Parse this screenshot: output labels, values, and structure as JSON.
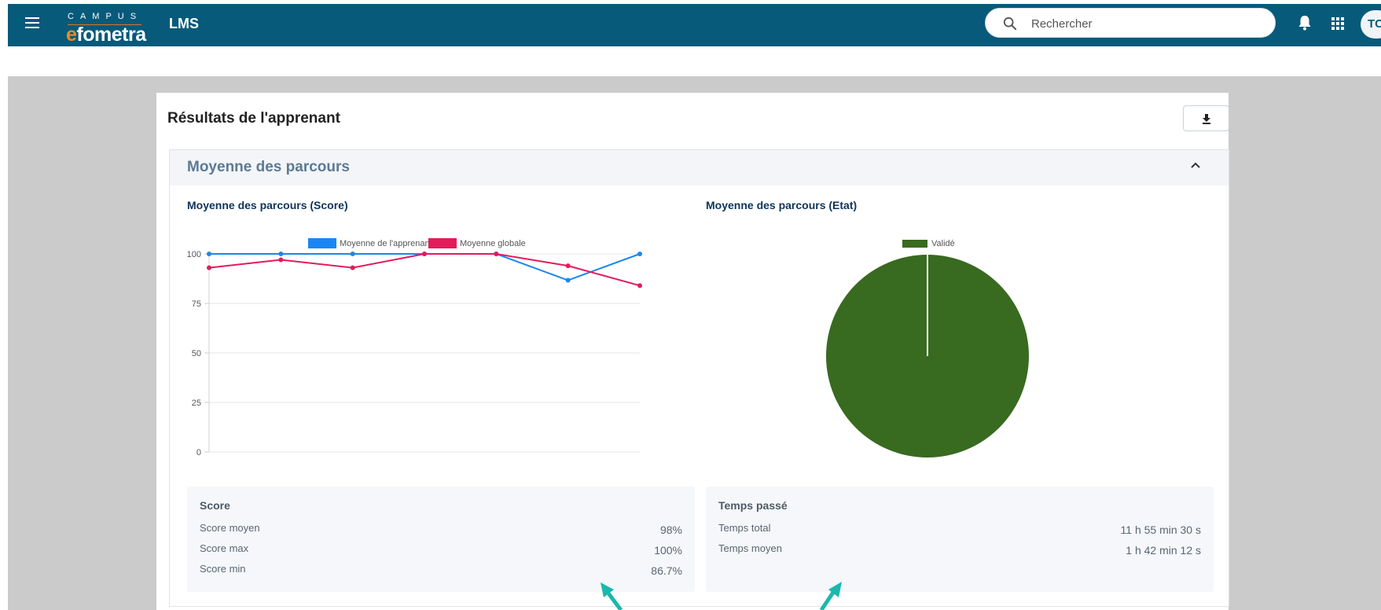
{
  "topbar": {
    "logo_top": "CAMPUS",
    "logo_e": "e",
    "logo_rest": "fometra",
    "app_title": "LMS",
    "search_placeholder": "Rechercher",
    "avatar_initials": "TC"
  },
  "card": {
    "title": "Résultats de l'apprenant",
    "section_title": "Moyenne des parcours"
  },
  "score_chart": {
    "title": "Moyenne des parcours (Score)"
  },
  "state_chart": {
    "title": "Moyenne des parcours (Etat)"
  },
  "chart_data": [
    {
      "type": "line",
      "title": "Moyenne des parcours (Score)",
      "x": [
        1,
        2,
        3,
        4,
        5,
        6,
        7
      ],
      "series": [
        {
          "name": "Moyenne de l'apprenant",
          "color": "#1a86f3",
          "values": [
            100,
            100,
            100,
            100,
            100,
            86.7,
            100
          ]
        },
        {
          "name": "Moyenne globale",
          "color": "#e31b5b",
          "values": [
            93,
            97,
            93,
            100,
            100,
            94,
            84
          ]
        }
      ],
      "yticks": [
        "100",
        "75",
        "50",
        "25",
        "0"
      ],
      "ylim": [
        0,
        100
      ],
      "grid": true,
      "legend": "top"
    },
    {
      "type": "pie",
      "title": "Moyenne des parcours (Etat)",
      "labels": [
        "Validé"
      ],
      "values": [
        100
      ],
      "colors": [
        "#386a1f"
      ],
      "legend": "top"
    }
  ],
  "score_stats": {
    "heading": "Score",
    "rows": [
      {
        "label": "Score moyen",
        "value": "98%"
      },
      {
        "label": "Score max",
        "value": "100%"
      },
      {
        "label": "Score min",
        "value": "86.7%"
      }
    ]
  },
  "time_stats": {
    "heading": "Temps passé",
    "rows": [
      {
        "label": "Temps total",
        "value": "11 h 55 min 30 s"
      },
      {
        "label": "Temps moyen",
        "value": "1 h 42 min 12 s"
      }
    ]
  },
  "colors": {
    "topbar": "#075a7a",
    "accent_orange": "#f08a24",
    "arrow": "#1bb8ad"
  }
}
